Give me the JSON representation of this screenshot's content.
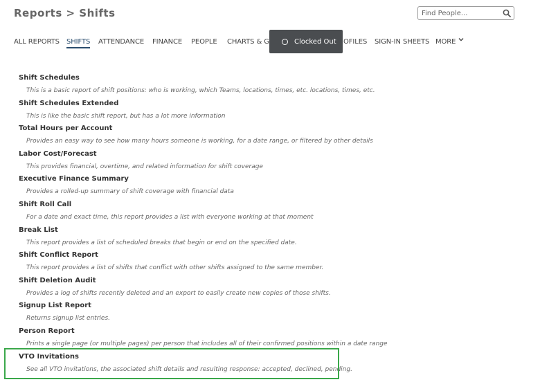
{
  "header": {
    "title": "Reports > Shifts",
    "search_placeholder": "Find People..."
  },
  "nav": {
    "items": [
      {
        "label": "ALL REPORTS",
        "active": false
      },
      {
        "label": "SHIFTS",
        "active": true
      },
      {
        "label": "ATTENDANCE",
        "active": false
      },
      {
        "label": "FINANCE",
        "active": false
      },
      {
        "label": "PEOPLE",
        "active": false
      },
      {
        "label": "CHARTS & GRA",
        "active": false
      },
      {
        "label": "OFILES",
        "active": false
      },
      {
        "label": "SIGN-IN SHEETS",
        "active": false
      },
      {
        "label": "MORE",
        "active": false
      }
    ]
  },
  "toast": {
    "label": "Clocked Out"
  },
  "reports": [
    {
      "title": "Shift Schedules",
      "desc": "This is a basic report of shift positions: who is working, which Teams, locations, times, etc. locations, times, etc."
    },
    {
      "title": "Shift Schedules Extended",
      "desc": "This is like the basic shift report, but has a lot more information"
    },
    {
      "title": "Total Hours per Account",
      "desc": "Provides an easy way to see how many hours someone is working, for a date range, or filtered by other details"
    },
    {
      "title": "Labor Cost/Forecast",
      "desc": "This provides financial, overtime, and related information for shift coverage"
    },
    {
      "title": "Executive Finance Summary",
      "desc": "Provides a rolled-up summary of shift coverage with financial data"
    },
    {
      "title": "Shift Roll Call",
      "desc": "For a date and exact time, this report provides a list with everyone working at that moment"
    },
    {
      "title": "Break List",
      "desc": "This report provides a list of scheduled breaks that begin or end on the specified date."
    },
    {
      "title": "Shift Conflict Report",
      "desc": "This report provides a list of shifts that conflict with other shifts assigned to the same member."
    },
    {
      "title": "Shift Deletion Audit",
      "desc": "Provides a log of shifts recently deleted and an export to easily create new copies of those shifts."
    },
    {
      "title": "Signup List Report",
      "desc": "Returns signup list entries."
    },
    {
      "title": "Person Report",
      "desc": "Prints a single page (or multiple pages) per person that includes all of their confirmed positions within a date range"
    },
    {
      "title": "VTO Invitations",
      "desc": "See all VTO invitations, the associated shift details and resulting response: accepted, declined, pending."
    }
  ],
  "colors": {
    "highlight": "#3aa84a",
    "toast_bg": "#4a4d50",
    "active_tab": "#2a4d6e"
  }
}
